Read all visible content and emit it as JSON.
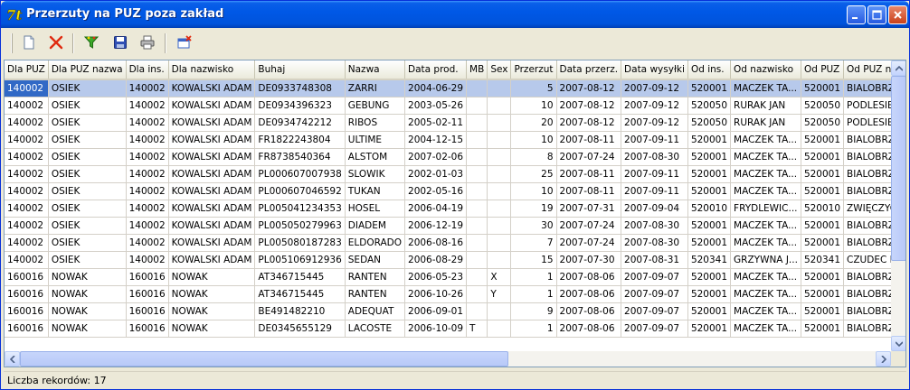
{
  "window": {
    "title": "Przerzuty na PUZ poza zakład",
    "app_icon": "7t-app-icon",
    "controls": [
      "minimize-icon",
      "maximize-icon",
      "close-icon"
    ]
  },
  "toolbar": {
    "buttons": [
      {
        "name": "new-document-icon"
      },
      {
        "name": "delete-x-icon"
      },
      {
        "name": "filter-funnel-icon"
      },
      {
        "name": "save-floppy-icon"
      },
      {
        "name": "printer-icon"
      },
      {
        "name": "close-window-icon"
      }
    ]
  },
  "grid": {
    "columns": [
      "Dla PUZ",
      "Dla PUZ nazwa",
      "Dla ins.",
      "Dla nazwisko",
      "Buhaj",
      "Nazwa",
      "Data prod.",
      "MB",
      "Sex",
      "Przerzut",
      "Data przerz.",
      "Data wysyłki",
      "Od ins.",
      "Od nazwisko",
      "Od PUZ",
      "Od PUZ na"
    ],
    "rows": [
      [
        "140002",
        "OSIEK",
        "140002",
        "KOWALSKI ADAM",
        "DE0933748308",
        "ZARRI",
        "2004-06-29",
        "",
        "",
        "5",
        "2007-08-12",
        "2007-09-12",
        "520001",
        "MACZEK TA...",
        "520001",
        "BIALOBRZ"
      ],
      [
        "140002",
        "OSIEK",
        "140002",
        "KOWALSKI ADAM",
        "DE0934396323",
        "GEBUNG",
        "2003-05-26",
        "",
        "",
        "10",
        "2007-08-12",
        "2007-09-12",
        "520050",
        "RURAK JAN",
        "520050",
        "PODLESIE"
      ],
      [
        "140002",
        "OSIEK",
        "140002",
        "KOWALSKI ADAM",
        "DE0934742212",
        "RIBOS",
        "2005-02-11",
        "",
        "",
        "20",
        "2007-08-12",
        "2007-09-12",
        "520050",
        "RURAK JAN",
        "520050",
        "PODLESIE"
      ],
      [
        "140002",
        "OSIEK",
        "140002",
        "KOWALSKI ADAM",
        "FR1822243804",
        "ULTIME",
        "2004-12-15",
        "",
        "",
        "10",
        "2007-08-11",
        "2007-09-11",
        "520001",
        "MACZEK TA...",
        "520001",
        "BIALOBRZ"
      ],
      [
        "140002",
        "OSIEK",
        "140002",
        "KOWALSKI ADAM",
        "FR8738540364",
        "ALSTOM",
        "2007-02-06",
        "",
        "",
        "8",
        "2007-07-24",
        "2007-08-30",
        "520001",
        "MACZEK TA...",
        "520001",
        "BIALOBRZ"
      ],
      [
        "140002",
        "OSIEK",
        "140002",
        "KOWALSKI ADAM",
        "PL000607007938",
        "SLOWIK",
        "2002-01-03",
        "",
        "",
        "25",
        "2007-08-11",
        "2007-09-11",
        "520001",
        "MACZEK TA...",
        "520001",
        "BIALOBRZ"
      ],
      [
        "140002",
        "OSIEK",
        "140002",
        "KOWALSKI ADAM",
        "PL000607046592",
        "TUKAN",
        "2002-05-16",
        "",
        "",
        "10",
        "2007-08-11",
        "2007-09-11",
        "520001",
        "MACZEK TA...",
        "520001",
        "BIALOBRZ"
      ],
      [
        "140002",
        "OSIEK",
        "140002",
        "KOWALSKI ADAM",
        "PL005041234353",
        "HOSEL",
        "2006-04-19",
        "",
        "",
        "19",
        "2007-07-31",
        "2007-09-04",
        "520010",
        "FRYDLEWIC...",
        "520010",
        "ZWIĘCZYC"
      ],
      [
        "140002",
        "OSIEK",
        "140002",
        "KOWALSKI ADAM",
        "PL005050279963",
        "DIADEM",
        "2006-12-19",
        "",
        "",
        "30",
        "2007-07-24",
        "2007-08-30",
        "520001",
        "MACZEK TA...",
        "520001",
        "BIALOBRZ"
      ],
      [
        "140002",
        "OSIEK",
        "140002",
        "KOWALSKI ADAM",
        "PL005080187283",
        "ELDORADO",
        "2006-08-16",
        "",
        "",
        "7",
        "2007-07-24",
        "2007-08-30",
        "520001",
        "MACZEK TA...",
        "520001",
        "BIALOBRZ"
      ],
      [
        "140002",
        "OSIEK",
        "140002",
        "KOWALSKI ADAM",
        "PL005106912936",
        "SEDAN",
        "2006-08-29",
        "",
        "",
        "15",
        "2007-07-30",
        "2007-08-31",
        "520341",
        "GRZYWNA J...",
        "520341",
        "CZUDEC I"
      ],
      [
        "160016",
        "NOWAK",
        "160016",
        "NOWAK",
        "AT346715445",
        "RANTEN",
        "2006-05-23",
        "",
        "X",
        "1",
        "2007-08-06",
        "2007-09-07",
        "520001",
        "MACZEK TA...",
        "520001",
        "BIALOBRZ"
      ],
      [
        "160016",
        "NOWAK",
        "160016",
        "NOWAK",
        "AT346715445",
        "RANTEN",
        "2006-10-26",
        "",
        "Y",
        "1",
        "2007-08-06",
        "2007-09-07",
        "520001",
        "MACZEK TA...",
        "520001",
        "BIALOBRZ"
      ],
      [
        "160016",
        "NOWAK",
        "160016",
        "NOWAK",
        "BE491482210",
        "ADEQUAT",
        "2006-09-01",
        "",
        "",
        "9",
        "2007-08-06",
        "2007-09-07",
        "520001",
        "MACZEK TA...",
        "520001",
        "BIALOBRZ"
      ],
      [
        "160016",
        "NOWAK",
        "160016",
        "NOWAK",
        "DE0345655129",
        "LACOSTE",
        "2006-10-09",
        "T",
        "",
        "1",
        "2007-08-06",
        "2007-09-07",
        "520001",
        "MACZEK TA...",
        "520001",
        "BIALOBRZ"
      ]
    ],
    "selected_row": 0
  },
  "status": {
    "record_count_text": "Liczba rekordów: 17"
  },
  "colors": {
    "titlebar": "#0058E6",
    "selection": "#3169C6",
    "selection_light": "#B7C9EB"
  }
}
